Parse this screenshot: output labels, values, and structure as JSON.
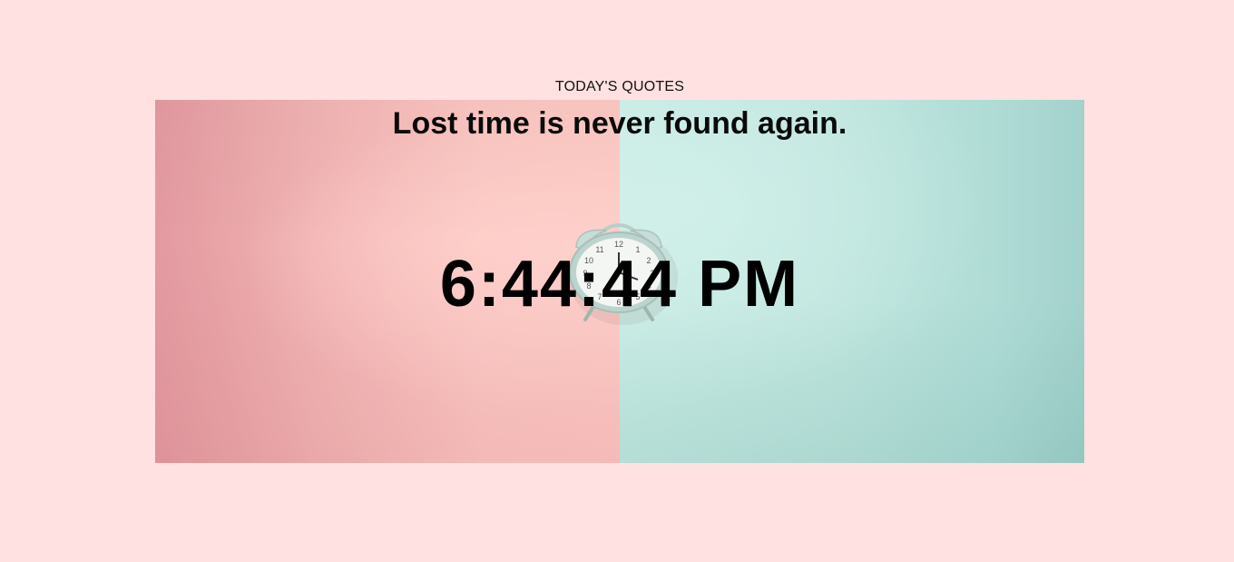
{
  "header": {
    "section_label": "TODAY'S QUOTES"
  },
  "hero": {
    "image_subject": "alarm-clock-icon",
    "quote": "Lost time is never found again.",
    "time": "6:44:44 PM"
  },
  "colors": {
    "page_background": "#ffe1e1",
    "left_panel": "#f7bcbc",
    "right_panel": "#bfe5de",
    "text": "#000000"
  }
}
